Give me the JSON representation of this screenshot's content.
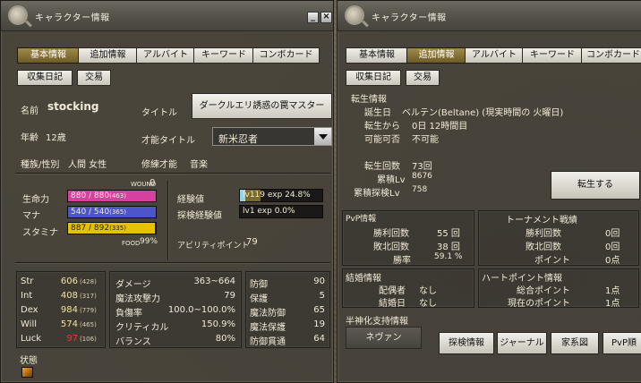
{
  "left": {
    "title": "キャラクター情報",
    "tabs": [
      "基本情報",
      "追加情報",
      "アルバイト",
      "キーワード",
      "コンボカード",
      "収集日記",
      "交易"
    ],
    "name_label": "名前",
    "name_value": "stocking",
    "title_label": "タイトル",
    "title_value": "ダークルエリ誘惑の罠マスター",
    "age_label": "年齢",
    "age_value": "12歳",
    "talent_title_label": "才能タイトル",
    "talent_title_value": "新米忍者",
    "race_label": "種族/性別",
    "race_value": "人間 女性",
    "training_label": "修練才能",
    "training_value": "音楽",
    "wound_label": "WOUND",
    "wound_value": "0",
    "hp_label": "生命力",
    "hp_value": "880 / 880",
    "hp_sub": "(463)",
    "hp_fill": 1.0,
    "mp_label": "マナ",
    "mp_value": "540 / 540",
    "mp_sub": "(365)",
    "mp_fill": 1.0,
    "sp_label": "スタミナ",
    "sp_value": "887 / 892",
    "sp_sub": "(335)",
    "sp_fill": 0.99,
    "food_label": "FOOD",
    "food_value": "99%",
    "exp_label": "経験値",
    "exp_value": "lv119 exp 24.8%",
    "exp_fill": 0.248,
    "explore_label": "探検経験値",
    "explore_value": "lv1 exp 0.0%",
    "explore_fill": 0.0,
    "ability_label": "アビリティポイント",
    "ability_value": "79",
    "stats": [
      {
        "name": "Str",
        "value": "606",
        "sub": "(428)"
      },
      {
        "name": "Int",
        "value": "408",
        "sub": "(317)"
      },
      {
        "name": "Dex",
        "value": "984",
        "sub": "(779)"
      },
      {
        "name": "Will",
        "value": "574",
        "sub": "(465)"
      },
      {
        "name": "Luck",
        "value": "97",
        "sub": "(106)"
      }
    ],
    "combat": [
      {
        "name": "ダメージ",
        "value": "363~664"
      },
      {
        "name": "魔法攻撃力",
        "value": "79"
      },
      {
        "name": "負傷率",
        "value": "100.0~100.0%"
      },
      {
        "name": "クリティカル",
        "value": "150.9%"
      },
      {
        "name": "バランス",
        "value": "80%"
      }
    ],
    "defense": [
      {
        "name": "防御",
        "value": "90"
      },
      {
        "name": "保護",
        "value": "5"
      },
      {
        "name": "魔法防御",
        "value": "65"
      },
      {
        "name": "魔法保護",
        "value": "19"
      },
      {
        "name": "防御貫通",
        "value": "64"
      }
    ],
    "status_label": "状態",
    "colors": {
      "hp": "#d6409e",
      "mp": "#4d55c9",
      "sp": "#e4c200",
      "exp": "#7b6a2e"
    }
  },
  "right": {
    "title": "キャラクター情報",
    "tabs": [
      "基本情報",
      "追加情報",
      "アルバイト",
      "キーワード",
      "コンボカード",
      "収集日記",
      "交易"
    ],
    "rebirth_header": "転生情報",
    "birthday_label": "誕生日",
    "birthday_value": "ベルテン(Beltane) (現実時間の 火曜日)",
    "since_label": "転生から",
    "since_value": "0日 12時間目",
    "possible_label": "可能可否",
    "possible_value": "不可能",
    "count_label": "転生回数",
    "count_value": "73回",
    "cumulative_label": "累積Lv",
    "cumulative_value": "8676",
    "explore_cum_label": "累積探検Lv",
    "explore_cum_value": "758",
    "rebirth_button": "転生する",
    "pvp_header": "PvP情報",
    "pvp_wins_label": "勝利回数",
    "pvp_wins_value": "55 回",
    "pvp_losses_label": "敗北回数",
    "pvp_losses_value": "38 回",
    "pvp_rate_label": "勝率",
    "pvp_rate_value": "59.1 %",
    "tour_header": "トーナメント戦績",
    "tour_wins_label": "勝利回数",
    "tour_wins_value": "0回",
    "tour_losses_label": "敗北回数",
    "tour_losses_value": "0回",
    "tour_points_label": "ポイント",
    "tour_points_value": "0点",
    "marriage_header": "結婚情報",
    "spouse_label": "配偶者",
    "spouse_value": "なし",
    "wedding_label": "結婚日",
    "wedding_value": "なし",
    "heart_header": "ハートポイント情報",
    "heart_total_label": "総合ポイント",
    "heart_total_value": "1点",
    "heart_current_label": "現在のポイント",
    "heart_current_value": "1点",
    "demigod_header": "半神化支持情報",
    "demigod_value": "ネヴァン",
    "buttons": [
      "探検情報",
      "ジャーナル",
      "家系図",
      "PvP順"
    ]
  }
}
